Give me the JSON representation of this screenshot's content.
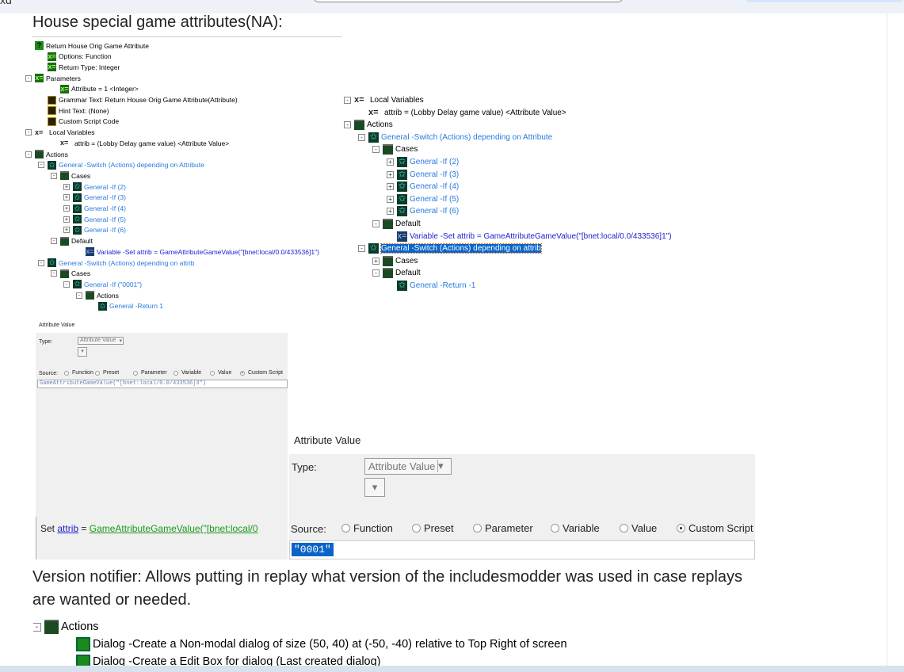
{
  "browser": {
    "partial_text": "xd"
  },
  "heading": "House special game attributes(NA):",
  "tree1": [
    {
      "l": 0,
      "icon": "q",
      "text": "Return House Orig Game Attribute"
    },
    {
      "l": 1,
      "icon": "green",
      "text": "Options: Function"
    },
    {
      "l": 1,
      "icon": "green",
      "text": "Return Type: Integer"
    },
    {
      "l": 0,
      "t": "-",
      "icon": "green",
      "text": "Parameters",
      "sub": 1
    },
    {
      "l": 2,
      "icon": "green",
      "text": "Attribute = 1 <Integer>"
    },
    {
      "l": 1,
      "icon": "doc",
      "text": "Grammar Text: Return House Orig Game Attribute(Attribute)"
    },
    {
      "l": 1,
      "icon": "doc",
      "text": "Hint Text: (None)"
    },
    {
      "l": 1,
      "icon": "doc",
      "text": "Custom Script Code"
    },
    {
      "l": 0,
      "t": "-",
      "icon": "var",
      "text": "Local Variables",
      "sub": 1
    },
    {
      "l": 2,
      "icon": "var",
      "text": "attrib = (Lobby Delay game value) <Attribute Value>"
    },
    {
      "l": 0,
      "t": "-",
      "icon": "clap",
      "text": "Actions",
      "sub": 1
    },
    {
      "l": 1,
      "t": "-",
      "icon": "star",
      "text": "General -Switch (Actions) depending on Attribute",
      "c": "blue",
      "sub": 1
    },
    {
      "l": 2,
      "t": "-",
      "icon": "clap",
      "text": "Cases",
      "sub": 1
    },
    {
      "l": 3,
      "t": "+",
      "icon": "star",
      "text": "General -If (2)",
      "c": "blue",
      "sub": 1
    },
    {
      "l": 3,
      "t": "+",
      "icon": "star",
      "text": "General -If (3)",
      "c": "blue",
      "sub": 1
    },
    {
      "l": 3,
      "t": "+",
      "icon": "star",
      "text": "General -If (4)",
      "c": "blue",
      "sub": 1
    },
    {
      "l": 3,
      "t": "+",
      "icon": "star",
      "text": "General -If (5)",
      "c": "blue",
      "sub": 1
    },
    {
      "l": 3,
      "t": "+",
      "icon": "star",
      "text": "General -If (6)",
      "c": "blue",
      "sub": 1
    },
    {
      "l": 2,
      "t": "-",
      "icon": "clap",
      "text": "Default",
      "sub": 1
    },
    {
      "l": 4,
      "icon": "varblue",
      "text": "Variable -Set attrib = GameAttributeGameValue(\"[bnet:local/0.0/433536]1\")",
      "c": "purple"
    },
    {
      "l": 1,
      "t": "-",
      "icon": "star",
      "text": "General -Switch (Actions) depending on attrib",
      "c": "blue",
      "sub": 1
    },
    {
      "l": 2,
      "t": "-",
      "icon": "clap",
      "text": "Cases",
      "sub": 1
    },
    {
      "l": 3,
      "t": "-",
      "icon": "star",
      "text": "General -If (\"0001\")",
      "c": "blue",
      "sub": 1
    },
    {
      "l": 4,
      "t": "-",
      "icon": "clap",
      "text": "Actions",
      "sub": 1
    },
    {
      "l": 5,
      "icon": "star",
      "text": "General -Return 1",
      "c": "blue"
    }
  ],
  "tree2": [
    {
      "l": 0,
      "t": "-",
      "icon": "var",
      "text": "Local Variables",
      "sub": 1
    },
    {
      "l": 1,
      "icon": "var",
      "text": "attrib = (Lobby Delay game value) <Attribute Value>"
    },
    {
      "l": 0,
      "t": "-",
      "icon": "clap",
      "text": "Actions",
      "sub": 1
    },
    {
      "l": 1,
      "t": "-",
      "icon": "star",
      "text": "General -Switch (Actions) depending on Attribute",
      "c": "blue",
      "sub": 1
    },
    {
      "l": 2,
      "t": "-",
      "icon": "clap",
      "text": "Cases",
      "sub": 1
    },
    {
      "l": 3,
      "t": "+",
      "icon": "star",
      "text": "General -If (2)",
      "c": "blue",
      "sub": 1
    },
    {
      "l": 3,
      "t": "+",
      "icon": "star",
      "text": "General -If (3)",
      "c": "blue",
      "sub": 1
    },
    {
      "l": 3,
      "t": "+",
      "icon": "star",
      "text": "General -If (4)",
      "c": "blue",
      "sub": 1
    },
    {
      "l": 3,
      "t": "+",
      "icon": "star",
      "text": "General -If (5)",
      "c": "blue",
      "sub": 1
    },
    {
      "l": 3,
      "t": "+",
      "icon": "star",
      "text": "General -If (6)",
      "c": "blue",
      "sub": 1
    },
    {
      "l": 2,
      "t": "-",
      "icon": "clap",
      "text": "Default",
      "sub": 1
    },
    {
      "l": 3,
      "icon": "varblue",
      "text": "Variable -Set attrib = GameAttributeGameValue(\"[bnet:local/0.0/433536]1\")",
      "c": "purple"
    },
    {
      "l": 1,
      "t": "-",
      "icon": "star",
      "text": "General -Switch (Actions) depending on attrib",
      "c": "sel",
      "sub": 1
    },
    {
      "l": 2,
      "t": "+",
      "icon": "clap",
      "text": "Cases",
      "sub": 1
    },
    {
      "l": 2,
      "t": "-",
      "icon": "clap",
      "text": "Default",
      "sub": 1
    },
    {
      "l": 3,
      "icon": "star",
      "text": "General -Return -1",
      "c": "blue"
    }
  ],
  "dialog1": {
    "title": "Attribute Value",
    "type_label": "Type:",
    "type_value": "Attribute Value",
    "source_label": "Source:",
    "sources": [
      "Function",
      "Preset",
      "Parameter",
      "Variable",
      "Value",
      "Custom Script"
    ],
    "selected_source": "Custom Script",
    "script": "GameAttributeGameValue(\"[bnet:local/0.0/433536]3\")"
  },
  "setline": {
    "prefix": "Set ",
    "var": "attrib",
    "eq": " = ",
    "func": "GameAttributeGameValue(\"[bnet:local/0"
  },
  "dialog2": {
    "title": "Attribute Value",
    "type_label": "Type:",
    "type_value": "Attribute Value",
    "source_label": "Source:",
    "sources": [
      "Function",
      "Preset",
      "Parameter",
      "Variable",
      "Value",
      "Custom Script"
    ],
    "selected_source": "Custom Script",
    "script": "\"0001\""
  },
  "paragraph": "Version notifier: Allows putting in replay what version of the includesmodder was used in case replays are wanted or needed.",
  "tree3": [
    {
      "l": 0,
      "t": "-",
      "icon": "clap",
      "text": "Actions",
      "sub": 1
    },
    {
      "l": 1,
      "icon": "dlg",
      "text": "Dialog -Create a Non-modal dialog of size (50, 40) at (-50, -40) relative to Top Right of screen"
    },
    {
      "l": 1,
      "icon": "dlg",
      "text": "Dialog -Create a Edit Box for dialog (Last created dialog)"
    }
  ],
  "colors": {
    "link_blue": "#2a7ae0",
    "selection": "#0a64c8",
    "dialog_bg": "#f0f0f0"
  }
}
